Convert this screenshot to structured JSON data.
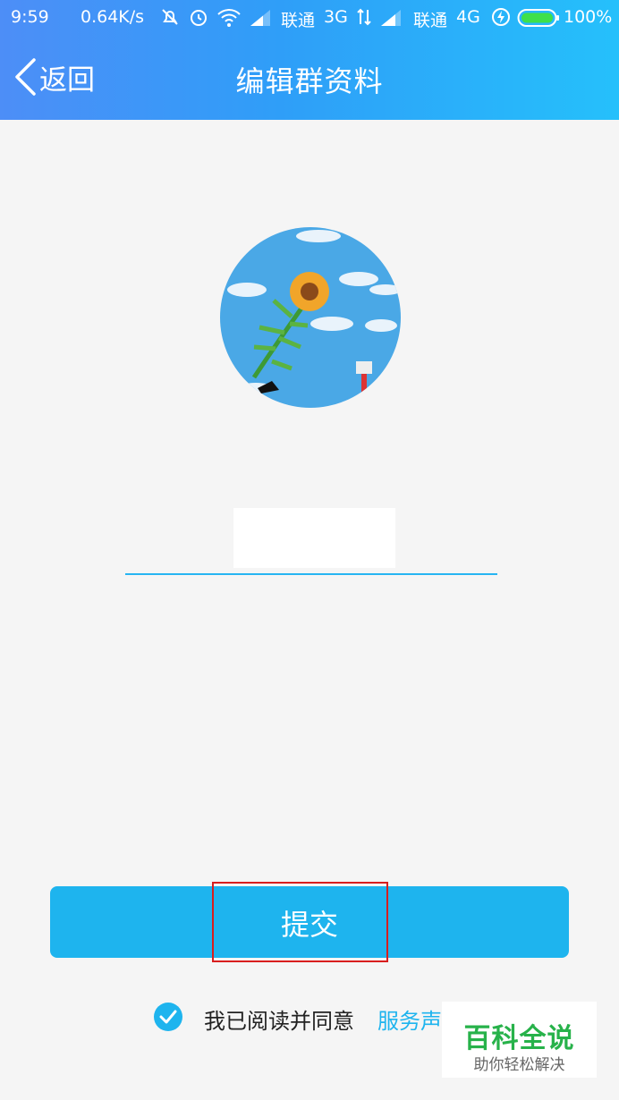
{
  "status_bar": {
    "time": "9:59",
    "speed": "0.64K/s",
    "carrier1": "联通",
    "net1": "3G",
    "carrier2": "联通",
    "net2": "4G",
    "battery": "100%",
    "icons": [
      "muted-bell-icon",
      "alarm-icon",
      "wifi-icon",
      "signal-icon",
      "data-arrows-icon",
      "signal-icon",
      "charging-icon",
      "battery-icon"
    ]
  },
  "nav": {
    "back_label": "返回",
    "title": "编辑群资料",
    "back_icon": "chevron-left-icon"
  },
  "group": {
    "name_value": ""
  },
  "actions": {
    "submit_label": "提交"
  },
  "agreement": {
    "checked": true,
    "text": "我已阅读并同意",
    "link_text": "服务声"
  },
  "watermark": {
    "title": "百科全说",
    "subtitle": "助你轻松解决"
  },
  "colors": {
    "header_gradient_start": "#4d8ef7",
    "header_gradient_end": "#25c0fb",
    "accent": "#1eb4ee",
    "highlight": "#d81e1e",
    "watermark_green": "#27b24a"
  }
}
